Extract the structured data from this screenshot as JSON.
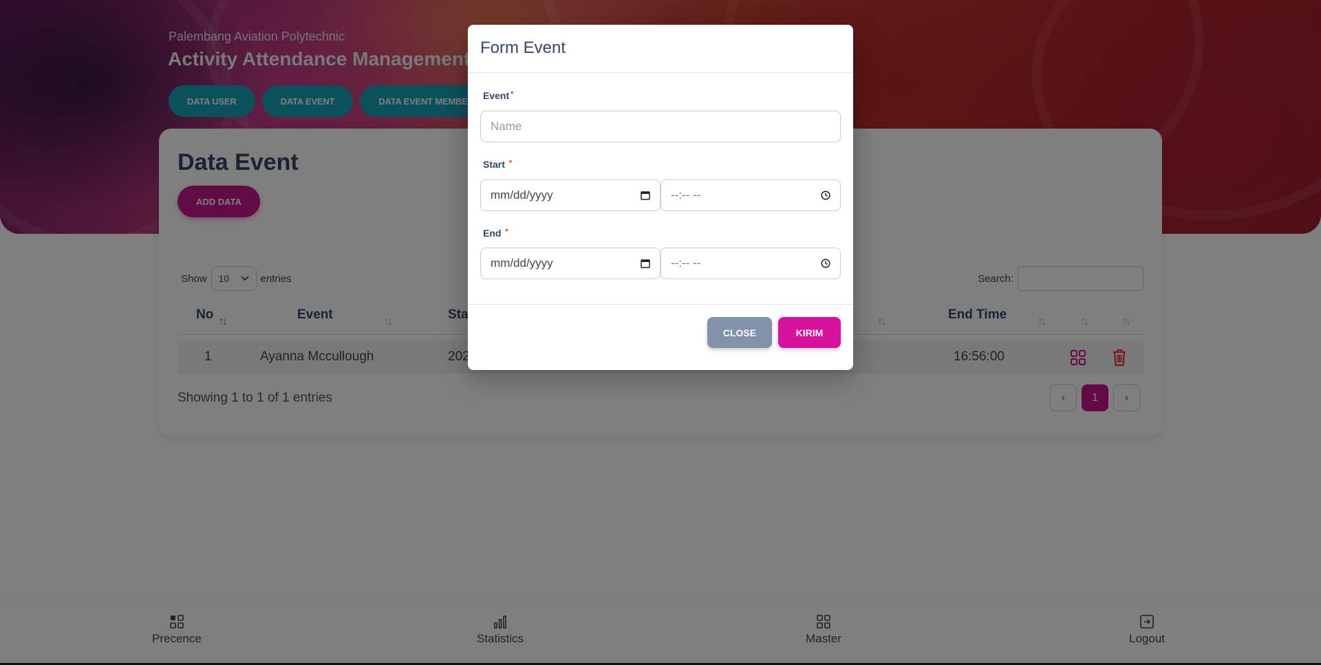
{
  "header": {
    "org_name": "Palembang Aviation Polytechnic",
    "app_title": "Activity Attendance Management Ap",
    "nav": [
      {
        "label": "DATA USER"
      },
      {
        "label": "DATA EVENT"
      },
      {
        "label": "DATA EVENT MEMBER"
      }
    ]
  },
  "card": {
    "title": "Data Event",
    "add_button": "ADD DATA",
    "show_label": "Show",
    "entries_value": "10",
    "entries_label": "entries",
    "search_label": "Search:",
    "columns": {
      "no": "No",
      "event": "Event",
      "start": "Star",
      "end_time": "End Time"
    },
    "rows": [
      {
        "no": "1",
        "event": "Ayanna Mccullough",
        "start": "202",
        "end_time": "16:56:00"
      }
    ],
    "showing_text": "Showing 1 to 1 of 1 entries",
    "pager": {
      "prev": "‹",
      "current": "1",
      "next": "›"
    }
  },
  "modal": {
    "title": "Form Event",
    "event_label": "Event",
    "event_placeholder": "Name",
    "start_label": "Start",
    "end_label": "End",
    "required_mark": "*",
    "date_placeholder": "mm/dd/yyyy",
    "time_placeholder": "--:-- --",
    "close_button": "CLOSE",
    "submit_button": "KIRIM"
  },
  "bottom_nav": [
    {
      "label": "Precence",
      "icon": "grid-check-icon"
    },
    {
      "label": "Statistics",
      "icon": "bar-chart-icon"
    },
    {
      "label": "Master",
      "icon": "grid-icon"
    },
    {
      "label": "Logout",
      "icon": "logout-icon"
    }
  ],
  "colors": {
    "accent": "#c7168f",
    "nav_pill": "#17a2b8",
    "close_button": "#8392ab",
    "delete_icon": "#e53935"
  }
}
